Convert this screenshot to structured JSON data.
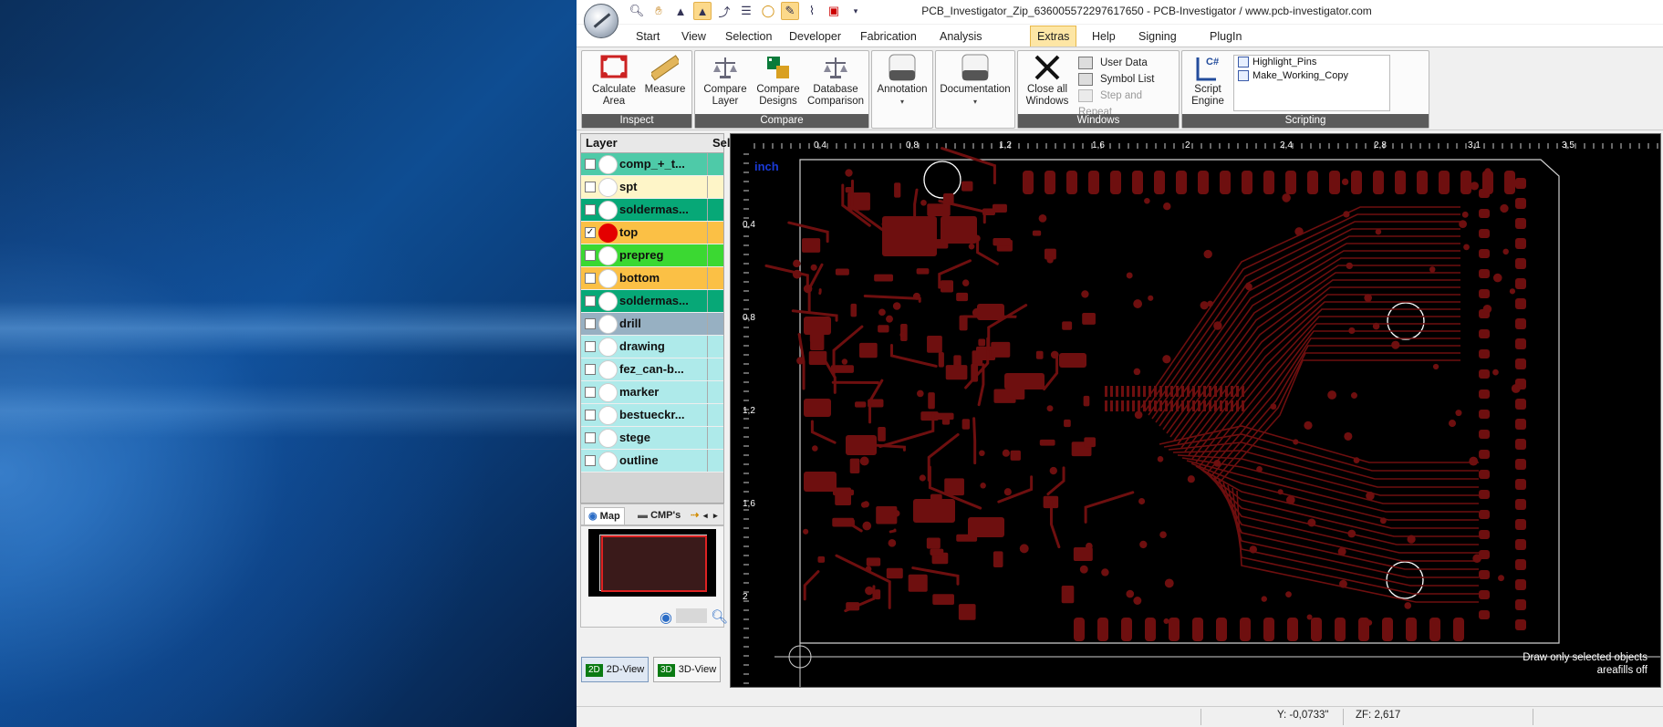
{
  "window": {
    "title": "PCB_Investigator_Zip_636005572297617650 - PCB-Investigator  /  www.pcb-investigator.com"
  },
  "quick_access": [
    "zoom-icon",
    "pan-hand-icon",
    "select-arrow-icon",
    "select-active-icon",
    "route-icon",
    "layer-icon",
    "circle-icon",
    "edit-pencil-icon",
    "paint-brush-icon",
    "red-window-icon",
    "dropdown-icon"
  ],
  "menu": {
    "tabs": [
      "Start",
      "View",
      "Selection",
      "Developer",
      "Fabrication",
      "Analysis",
      "Extras",
      "Help",
      "Signing",
      "PlugIn"
    ],
    "active": "Extras"
  },
  "ribbon": {
    "inspect": {
      "label": "Inspect",
      "calculate_area": "Calculate Area",
      "measure": "Measure"
    },
    "compare": {
      "label": "Compare",
      "compare_layer": "Compare Layer",
      "compare_designs": "Compare Designs",
      "database_comparison": "Database Comparison"
    },
    "annotation": {
      "label": "Annotation"
    },
    "documentation": {
      "label": "Documentation"
    },
    "windows": {
      "label": "Windows",
      "close_all": "Close all Windows",
      "user_data": "User Data",
      "symbol_list": "Symbol List",
      "step_repeat": "Step and Repeat"
    },
    "scripting": {
      "label": "Scripting",
      "script_engine": "Script Engine",
      "scripts": [
        "Highlight_Pins",
        "Make_Working_Copy"
      ]
    }
  },
  "layers": {
    "header_layer": "Layer",
    "header_sel": "Sel.",
    "items": [
      {
        "name": "comp_+_t...",
        "checked": false,
        "dot": "#ffffff",
        "bg": "#4ecaa8"
      },
      {
        "name": "spt",
        "checked": false,
        "dot": "#ffffff",
        "bg": "#fef5c8"
      },
      {
        "name": "soldermas...",
        "checked": false,
        "dot": "#ffffff",
        "bg": "#07a877"
      },
      {
        "name": "top",
        "checked": true,
        "dot": "#e40000",
        "bg": "#fbc045"
      },
      {
        "name": "prepreg",
        "checked": false,
        "dot": "#ffffff",
        "bg": "#3bd832"
      },
      {
        "name": "bottom",
        "checked": false,
        "dot": "#ffffff",
        "bg": "#fbc045"
      },
      {
        "name": "soldermas...",
        "checked": false,
        "dot": "#ffffff",
        "bg": "#07a877"
      },
      {
        "name": "drill",
        "checked": false,
        "dot": "#ffffff",
        "bg": "#97b0c2"
      },
      {
        "name": "drawing",
        "checked": false,
        "dot": "#ffffff",
        "bg": "#aeeaea"
      },
      {
        "name": "fez_can-b...",
        "checked": false,
        "dot": "#ffffff",
        "bg": "#aeeaea"
      },
      {
        "name": "marker",
        "checked": false,
        "dot": "#ffffff",
        "bg": "#aeeaea"
      },
      {
        "name": "bestueckr...",
        "checked": false,
        "dot": "#ffffff",
        "bg": "#aeeaea"
      },
      {
        "name": "stege",
        "checked": false,
        "dot": "#ffffff",
        "bg": "#aeeaea"
      },
      {
        "name": "outline",
        "checked": false,
        "dot": "#ffffff",
        "bg": "#aeeaea"
      }
    ]
  },
  "navigator": {
    "tab_map": "Map",
    "tab_cmps": "CMP's"
  },
  "views": {
    "view_2d": "2D-View",
    "view_2d_badge": "2D",
    "view_3d": "3D-View",
    "view_3d_badge": "3D"
  },
  "canvas": {
    "unit": "inch",
    "x_ticks": [
      "0,4",
      "0,8",
      "1,2",
      "1,6",
      "2",
      "2,4",
      "2,8",
      "3,1",
      "3,5"
    ],
    "y_ticks": [
      "0,4",
      "0,8",
      "1,2",
      "1,6",
      "2"
    ],
    "hint_line1": "Draw only selected objects",
    "hint_line2": "areafills off",
    "trace_color": "#6e0f0f"
  },
  "status": {
    "y_coord": "Y: -0,0733\"",
    "zoom": "ZF: 2,617"
  }
}
